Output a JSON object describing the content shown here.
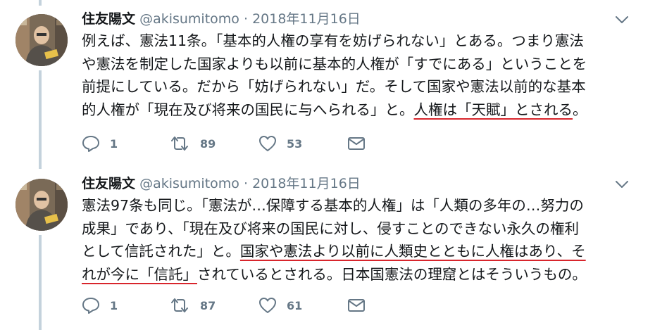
{
  "tweets": [
    {
      "name": "住友陽文",
      "handle": "@akisumitomo",
      "separator": "·",
      "date": "2018年11月16日",
      "lines": [
        [
          "例えば、憲法11条。「基本的人権の享有を妨げられない」とある。つまり憲法"
        ],
        [
          "や憲法を制定した国家よりも以前に基本的人権が「すでにある」ということを"
        ],
        [
          "前提にしている。だから「妨げられない」だ。そして国家や憲法以前的な基本"
        ],
        [
          "的人権が「現在及び将来の国民に与へられる」と。",
          "人権は「天賦」とされる",
          "。"
        ]
      ],
      "replies": "1",
      "retweets": "89",
      "likes": "53"
    },
    {
      "name": "住友陽文",
      "handle": "@akisumitomo",
      "separator": "·",
      "date": "2018年11月16日",
      "lines": [
        [
          "憲法97条も同じ。「憲法が…保障する基本的人権」は「人類の多年の…努力の"
        ],
        [
          "成果」であり、「現在及び将来の国民に対し、侵すことのできない永久の権利"
        ],
        [
          "として信託された」と。",
          "国家や憲法より以前に人類史とともに人権はあり、そ"
        ],
        [
          "",
          "れが今に「信託」",
          "されているとされる。日本国憲法の理窟とはそういうもの。"
        ]
      ],
      "replies": "1",
      "retweets": "87",
      "likes": "61"
    }
  ],
  "icons": {
    "more": "chevron-down-icon",
    "reply": "reply-icon",
    "retweet": "retweet-icon",
    "like": "heart-icon",
    "dm": "envelope-icon"
  },
  "colors": {
    "text": "#14171a",
    "secondary": "#657786",
    "underline": "#d8252c",
    "thread_line": "#c4d2dc"
  }
}
